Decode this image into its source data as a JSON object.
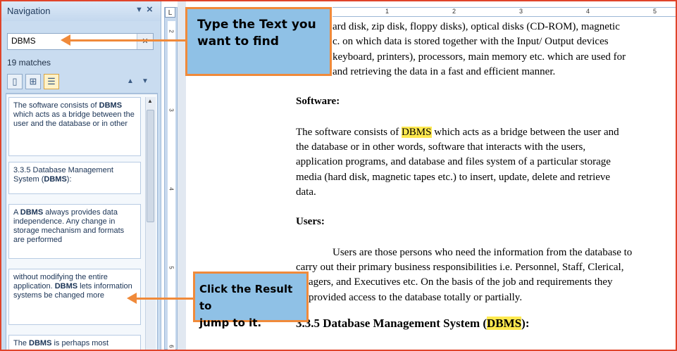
{
  "navigation": {
    "title": "Navigation",
    "search_value": "DBMS",
    "match_count": "19 matches",
    "results": [
      {
        "parts": [
          "The software consists of ",
          "DBMS",
          " which acts as a bridge between the user and the database or in other"
        ]
      },
      {
        "parts": [
          "3.3.5  Database Management System (",
          "DBMS",
          "):"
        ]
      },
      {
        "parts": [
          "A ",
          "DBMS",
          " always provides data independence. Any change in storage mechanism and formats are performed"
        ]
      },
      {
        "parts": [
          "without modifying the entire application. ",
          "DBMS",
          " lets information systems be changed more"
        ]
      },
      {
        "parts": [
          "The ",
          "DBMS",
          " is perhaps most"
        ]
      }
    ]
  },
  "ruler": {
    "horizontal_numbers": [
      "1",
      "2",
      "3",
      "4",
      "5"
    ],
    "vertical_numbers": [
      "2",
      "3",
      "4",
      "5",
      "6"
    ],
    "corner": "L"
  },
  "document": {
    "para1_lines": [
      "ard disk, zip disk, floppy disks), optical disks (CD-ROM), magnetic",
      "c. on which data is stored together with the Input/ Output devices",
      "keyboard, printers), processors, main memory etc. which are used for",
      "and retrieving the data in a  fast and efficient manner."
    ],
    "heading_software": "Software:",
    "software_highlight": "DBMS",
    "software_first_prefix": "The software consists of ",
    "software_first_suffix": " which acts as a bridge between the user and",
    "software_lines": [
      "the database or in other words, software that interacts with the users,",
      "application programs,  and database and files system of a particular storage",
      "media (hard disk, magnetic tapes etc.) to insert, update, delete and retrieve",
      "data."
    ],
    "heading_users": "Users:",
    "users_lines": [
      "Users are those persons who need the information from the database to",
      "carry out their primary business responsibilities  i.e. Personnel, Staff, Clerical,",
      "agers, and Executives etc. On the basis of the job and requirements  they",
      "provided access to the database totally or partially."
    ],
    "section_heading_prefix": "3.3.5  Database Management System (",
    "section_heading_highlight": "DBMS",
    "section_heading_suffix": "):"
  },
  "callouts": {
    "type_text": [
      "Type the Text you",
      "want to find"
    ],
    "click_result": [
      "Click the Result to",
      "jump to it."
    ]
  },
  "colors": {
    "accent_orange": "#f08a3a",
    "callout_blue": "#8fc1e6",
    "highlight_yellow": "#ffe94f",
    "frame_red": "#e0442a"
  }
}
